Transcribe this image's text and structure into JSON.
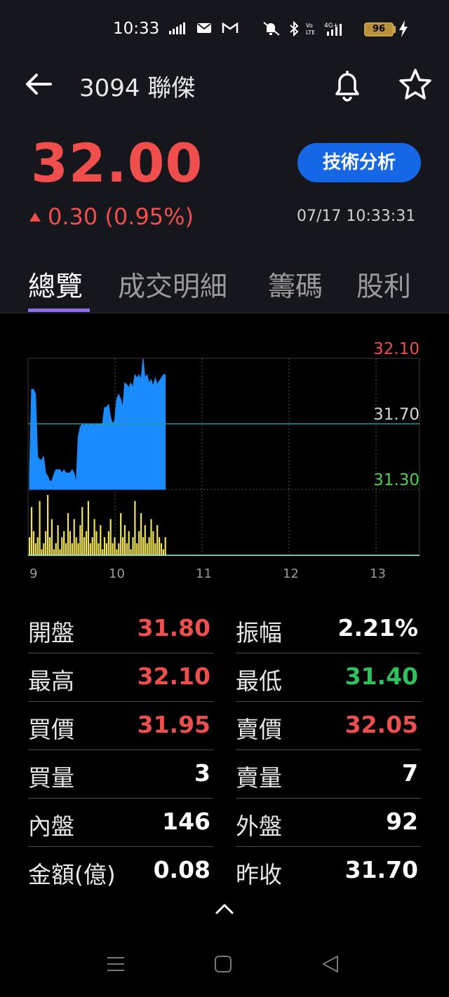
{
  "status_bar": {
    "time": "10:33",
    "battery": "96"
  },
  "header": {
    "title": "3094 聯傑"
  },
  "quote": {
    "price": "32.00",
    "change": "0.30 (0.95%)",
    "timestamp": "07/17 10:33:31",
    "tech_analysis_label": "技術分析"
  },
  "tabs": [
    {
      "label": "總覽"
    },
    {
      "label": "成交明細"
    },
    {
      "label": "籌碼"
    },
    {
      "label": "股利"
    }
  ],
  "chart_data": {
    "type": "area",
    "y_ticks": [
      {
        "label": "32.10",
        "value": 32.1,
        "color": "#f04d4d"
      },
      {
        "label": "31.70",
        "value": 31.7,
        "color": "#d8d8d8"
      },
      {
        "label": "31.30",
        "value": 31.3,
        "color": "#4cd24c"
      }
    ],
    "x_ticks": [
      "9",
      "10",
      "11",
      "12",
      "13"
    ],
    "ylim": [
      31.3,
      32.1
    ],
    "reference": 31.7,
    "series": [
      {
        "values": [
          31.4,
          31.91,
          31.91,
          31.88,
          31.5,
          31.48,
          31.48,
          31.5,
          31.4,
          31.38,
          31.35,
          31.35,
          31.39,
          31.42,
          31.42,
          31.42,
          31.4,
          31.42,
          31.4,
          31.4,
          31.4,
          31.42,
          31.4,
          31.34,
          31.62,
          31.68,
          31.7,
          31.69,
          31.7,
          31.69,
          31.7,
          31.7,
          31.69,
          31.7,
          31.7,
          31.7,
          31.7,
          31.8,
          31.8,
          31.82,
          31.74,
          31.7,
          31.72,
          31.85,
          31.88,
          31.85,
          31.8,
          31.95,
          31.94,
          31.92,
          31.95,
          31.92,
          32.0,
          31.98,
          32.0,
          31.97,
          32.1,
          31.98,
          32.0,
          31.95,
          31.97,
          31.93,
          31.98,
          31.94,
          31.96,
          31.98,
          32.0,
          32.0
        ]
      },
      {
        "values": [
          3,
          8,
          4,
          2,
          3,
          9,
          1,
          2,
          4,
          10,
          3,
          6,
          1,
          2,
          5,
          1,
          3,
          4,
          2,
          7,
          4,
          2,
          6,
          3,
          2,
          5,
          8,
          3,
          4,
          9,
          2,
          3,
          6,
          4,
          2,
          5,
          1,
          3,
          2,
          4,
          6,
          2,
          3,
          1,
          2,
          7,
          3,
          5,
          2,
          4,
          1,
          3,
          9,
          2,
          4,
          7,
          3,
          5,
          2,
          3,
          6,
          4,
          2,
          5,
          3,
          2,
          1,
          3
        ]
      }
    ]
  },
  "stats": [
    {
      "left_label": "開盤",
      "left_value": "31.80",
      "left_color": "red",
      "right_label": "振幅",
      "right_value": "2.21%",
      "right_color": "white"
    },
    {
      "left_label": "最高",
      "left_value": "32.10",
      "left_color": "red",
      "right_label": "最低",
      "right_value": "31.40",
      "right_color": "green"
    },
    {
      "left_label": "買價",
      "left_value": "31.95",
      "left_color": "red",
      "right_label": "賣價",
      "right_value": "32.05",
      "right_color": "red"
    },
    {
      "left_label": "買量",
      "left_value": "3",
      "left_color": "white",
      "right_label": "賣量",
      "right_value": "7",
      "right_color": "white"
    },
    {
      "left_label": "內盤",
      "left_value": "146",
      "left_color": "white",
      "right_label": "外盤",
      "right_value": "92",
      "right_color": "white"
    },
    {
      "left_label": "金額(億)",
      "left_value": "0.08",
      "left_color": "white",
      "right_label": "昨收",
      "right_value": "31.70",
      "right_color": "white"
    }
  ],
  "colors": {
    "accent": "#1567e6",
    "up": "#f04d4d",
    "down": "#2fc15a",
    "tab_indicator": "#8c6ee6",
    "volume": "#f0e35a"
  }
}
